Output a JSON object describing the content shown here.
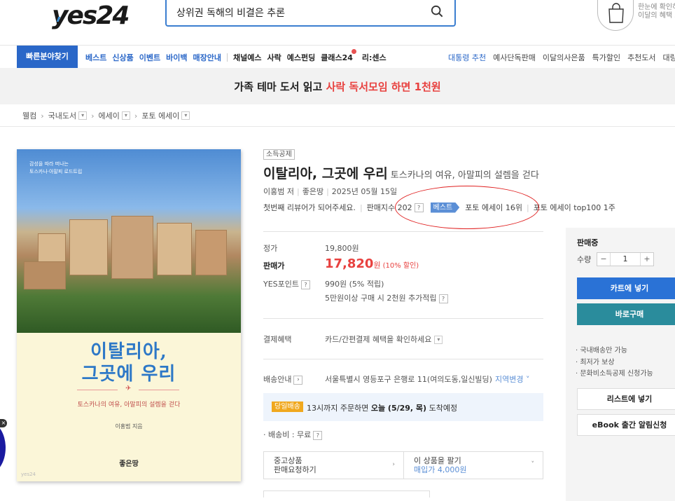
{
  "header": {
    "logo": "yes24",
    "search_query": "상위권 독해의 비결은 추론",
    "cart_promo_line1": "한눈에 확인하",
    "cart_promo_line2": "이달의 혜택 모"
  },
  "gnb": {
    "quick_find": "빠른분야찾기",
    "left_items": [
      "베스트",
      "신상품",
      "이벤트",
      "바이백",
      "매장안내"
    ],
    "dark_items": [
      "채널예스",
      "사락",
      "예스펀딩",
      "클래스24",
      "리:센스"
    ],
    "right_items": [
      "대통령 추천",
      "예사단독판매",
      "이달의사은품",
      "특가할인",
      "추천도서",
      "대량"
    ]
  },
  "banner": {
    "text_prefix": "가족 테마 도서 읽고",
    "text_highlight": "사락 독서모임 하면 1천원"
  },
  "breadcrumb": [
    "웰컴",
    "국내도서",
    "에세이",
    "포토 에세이"
  ],
  "cover": {
    "top_small_1": "감성을 따라 떠나는",
    "top_small_2": "토스카나·아말피 로드트립",
    "title_line1": "이탈리아,",
    "title_line2": "그곳에 우리",
    "subtitle": "토스카나의 여유, 아말피의 설렘을 걷다",
    "author": "이홍범 지음",
    "publisher": "좋은땅",
    "watermark": "yes24"
  },
  "book": {
    "tax_badge": "소득공제",
    "title": "이탈리아, 그곳에 우리",
    "subtitle": "토스카나의 여유, 아말피의 설렘을 걷다",
    "author": "이홍범 저",
    "publisher": "좋은땅",
    "date": "2025년 05월 15일",
    "review_prompt": "첫번째 리뷰어가 되어주세요.",
    "sales_index_label": "판매지수 202",
    "best_label": "베스트",
    "rank1": "포토 에세이 16위",
    "rank2": "포토 에세이 top100 1주"
  },
  "price": {
    "list_label": "정가",
    "list_value": "19,800원",
    "sale_label": "판매가",
    "sale_value": "17,820",
    "sale_unit": "원",
    "discount": "(10% 할인)",
    "point_label": "YES포인트",
    "point_value": "990원 (5% 적립)",
    "point_extra": "5만원이상 구매 시 2천원 추가적립"
  },
  "payment": {
    "label": "결제혜택",
    "value": "카드/간편결제 혜택을 확인하세요"
  },
  "shipping": {
    "label": "배송안내",
    "address": "서울특별시 영등포구 은행로 11(여의도동,일신빌딩)",
    "change_link": "지역변경",
    "same_day_tag": "당일배송",
    "same_day_text_1": "13시까지 주문하면",
    "same_day_text_bold": "오늘 (5/29, 목)",
    "same_day_text_2": "도착예정",
    "fee": "배송비 : 무료"
  },
  "sell": {
    "left_line1": "중고상품",
    "left_line2": "판매요청하기",
    "right_line1": "이 상품을 팔기",
    "right_line2": "매입가 4,000원"
  },
  "sidebar": {
    "status": "판매중",
    "qty_label": "수량",
    "qty_value": "1",
    "cart_btn": "카트에 넣기",
    "buy_btn": "바로구매",
    "notes": [
      "국내배송만 가능",
      "최저가 보상",
      "문화비소득공제 신청가능"
    ],
    "list_btn": "리스트에 넣기",
    "ebook_btn": "eBook 출간 알림신청"
  },
  "colors": {
    "brand_blue": "#2a67c8",
    "price_red": "#e8413f",
    "buy_teal": "#2a8c9c"
  }
}
